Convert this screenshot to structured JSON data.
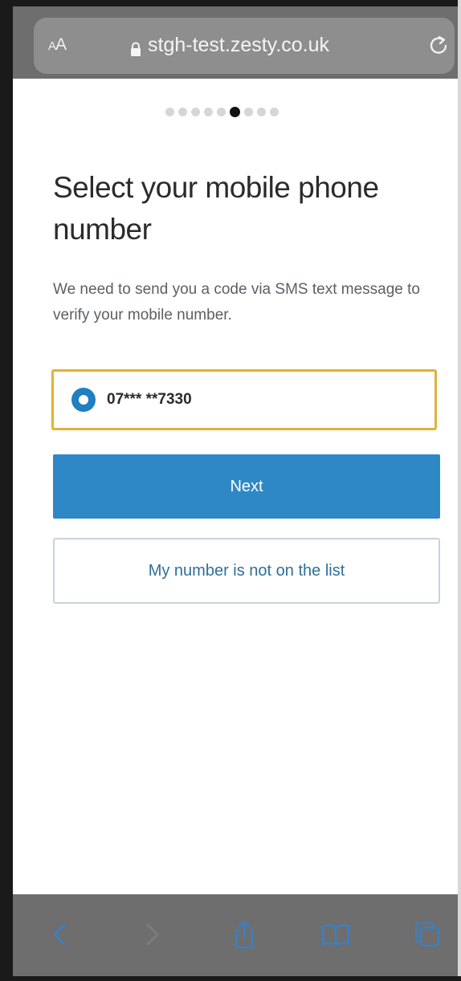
{
  "browser": {
    "reader_label_small": "A",
    "reader_label_large": "A",
    "url": "stgh-test.zesty.co.uk",
    "icons": [
      "lock-icon",
      "reload-icon",
      "back-icon",
      "forward-icon",
      "share-icon",
      "bookmarks-icon",
      "tabs-icon"
    ],
    "bar_color": "#6e6e6e"
  },
  "progress": {
    "total_steps": 9,
    "current_step": 6
  },
  "main": {
    "title": "Select your mobile phone number",
    "description": "We need to send you a code via SMS text message to verify your mobile number.",
    "phone_option": {
      "label": "07*** **7330",
      "selected": true
    },
    "next_button": "Next",
    "not_listed_button": "My number is not on the list"
  },
  "colors": {
    "primary": "#2f88c6",
    "focus": "#e0b13a",
    "radio": "#1f7fc1"
  }
}
